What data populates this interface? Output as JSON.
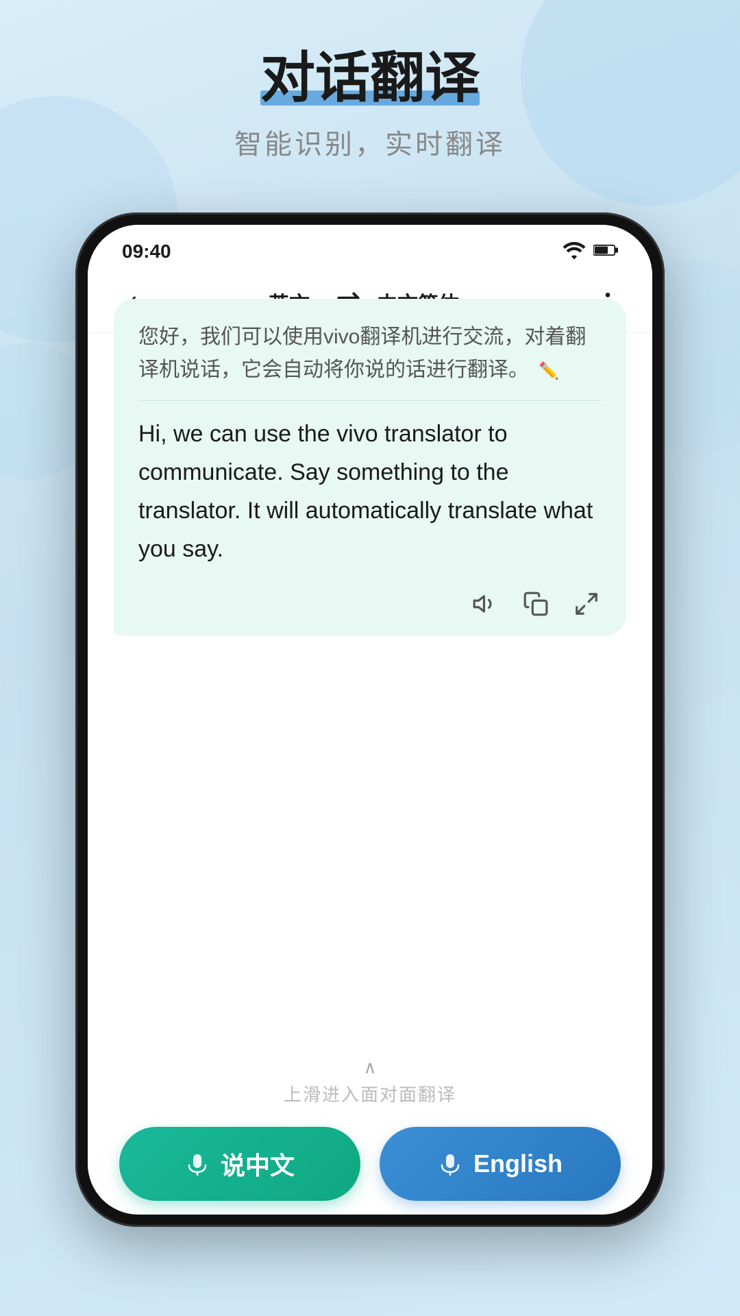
{
  "background": {
    "gradient_start": "#d8edf8",
    "gradient_end": "#c5e0f0"
  },
  "header": {
    "main_title": "对话翻译",
    "sub_title": "智能识别，实时翻译"
  },
  "status_bar": {
    "time": "09:40"
  },
  "nav": {
    "source_lang": "英文",
    "target_lang": "中文简体",
    "chevron": "▾"
  },
  "chat": {
    "chinese_text": "您好，我们可以使用vivo翻译机进行交流，对着翻译机说话，它会自动将你说的话进行翻译。",
    "english_text": "Hi, we can use the vivo translator to communicate. Say something to the translator. It will  automatically translate what you say."
  },
  "bottom": {
    "slide_hint": "上滑进入面对面翻译",
    "btn_chinese_label": "说中文",
    "btn_english_label": "English"
  }
}
